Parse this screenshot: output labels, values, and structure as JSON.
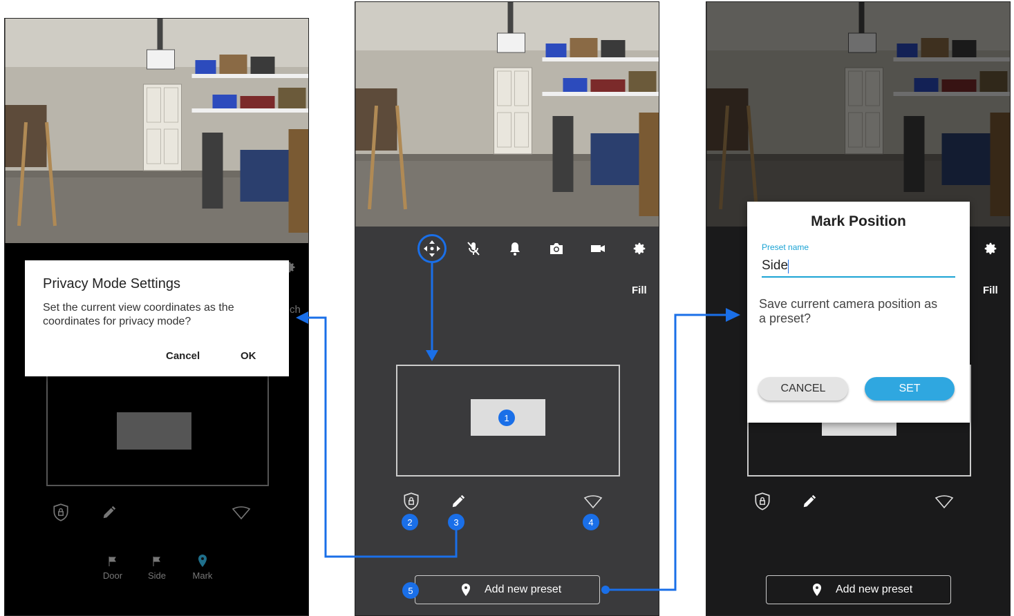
{
  "left": {
    "dialog": {
      "title": "Privacy Mode Settings",
      "message_line1": "Set the current view coordinates as the",
      "message_line2": "coordinates for privacy mode?",
      "cancel_label": "Cancel",
      "ok_label": "OK"
    },
    "partial_label": "ch",
    "presets": [
      {
        "label": "Door"
      },
      {
        "label": "Side"
      },
      {
        "label": "Mark"
      }
    ]
  },
  "middle": {
    "fill_label": "Fill",
    "badges": [
      "1",
      "2",
      "3",
      "4",
      "5"
    ],
    "add_preset_label": "Add new preset"
  },
  "right": {
    "fill_label": "Fill",
    "dialog": {
      "title": "Mark Position",
      "field_label": "Preset name",
      "field_value": "Side",
      "message_line1": "Save current camera position as",
      "message_line2": "a preset?",
      "cancel_label": "CANCEL",
      "set_label": "SET"
    },
    "add_preset_label": "Add new preset"
  },
  "colors": {
    "accent_blue": "#1a6fe8",
    "teal": "#1aa3d4",
    "panel_dark": "#3a3a3c",
    "panel_black": "#000000"
  }
}
